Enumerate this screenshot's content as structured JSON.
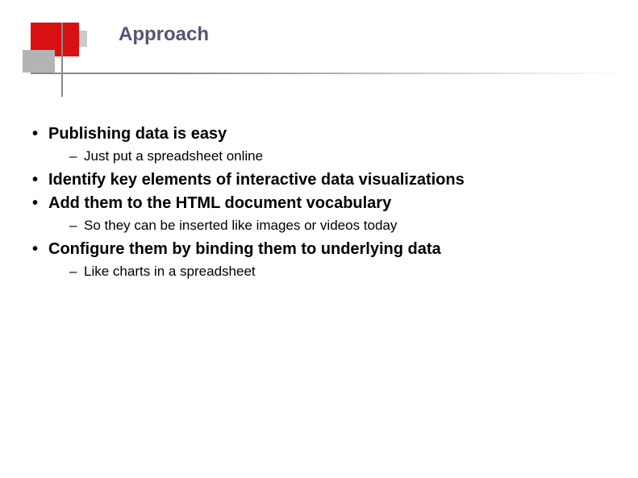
{
  "title": "Approach",
  "bullets": [
    {
      "level": 1,
      "text": "Publishing data is easy"
    },
    {
      "level": 2,
      "text": "Just put a spreadsheet online"
    },
    {
      "level": 1,
      "text": "Identify key elements of interactive data visualizations"
    },
    {
      "level": 1,
      "text": "Add them to the HTML document vocabulary"
    },
    {
      "level": 2,
      "text": "So they can be inserted like images or videos today"
    },
    {
      "level": 1,
      "text": "Configure them by binding them to underlying data"
    },
    {
      "level": 2,
      "text": "Like charts in a spreadsheet"
    }
  ]
}
